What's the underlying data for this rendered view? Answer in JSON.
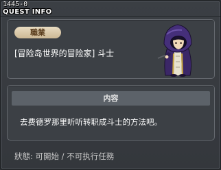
{
  "window": {
    "quest_id": "1445-0",
    "title": "QUEST INFO"
  },
  "quest": {
    "tag_label": "職業",
    "title": "[冒险岛世界的冒险家] 斗士"
  },
  "content": {
    "header": "内容",
    "body": "去费德罗那里听听转职成斗士的方法吧。"
  },
  "status": {
    "line": "狀態:  可開始  /  不可执行任務"
  },
  "icons": {
    "character": "hooded-mage-character-icon"
  },
  "colors": {
    "tag_background": "#ddcaa6",
    "tag_text": "#5a3d1d",
    "content_header_background": "#5c6269",
    "cloak_purple": "#3b2767"
  }
}
